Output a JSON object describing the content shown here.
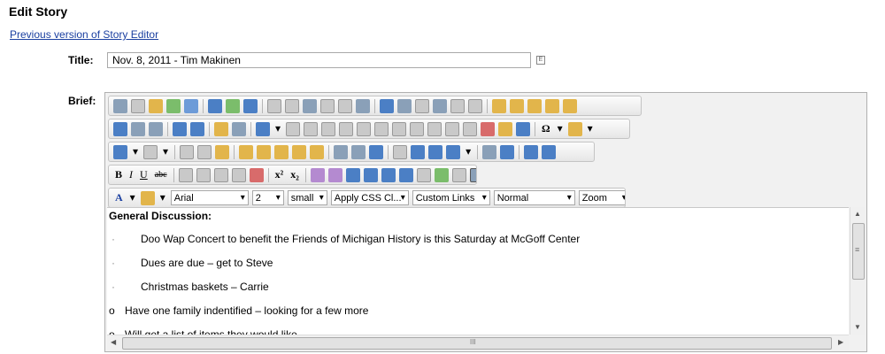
{
  "page": {
    "heading": "Edit Story",
    "previous_link": "Previous version of Story Editor",
    "title_label": "Title:",
    "title_value": "Nov. 8, 2011 - Tim Makinen",
    "brief_label": "Brief:"
  },
  "toolbar": {
    "font_name": "Arial",
    "font_size": "2",
    "css_size": "small",
    "apply_css": "Apply CSS Cl...",
    "custom_links": "Custom Links",
    "paragraph_style": "Normal",
    "zoom": "Zoom",
    "glyphs": {
      "bold": "B",
      "italic": "I",
      "underline": "U",
      "strike": "abc",
      "superscript": "x²",
      "subscript": "x₂",
      "font_color": "A",
      "omega": "Ω"
    }
  },
  "content": {
    "heading": "General Discussion:",
    "bullet_dot": "·",
    "bullet_o": "o",
    "lines": [
      "Doo Wap Concert to benefit the Friends of Michigan History is this Saturday at McGoff Center",
      "Dues are due – get to Steve",
      "Christmas baskets – Carrie",
      "Have one family indentified – looking for a few more",
      "Will get a list of items they would like"
    ]
  },
  "scroll": {
    "grip": "≡",
    "grip_h": "III"
  }
}
